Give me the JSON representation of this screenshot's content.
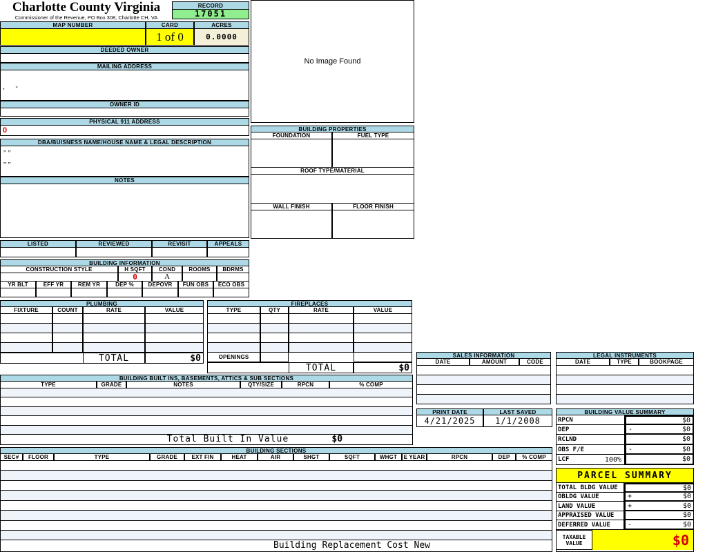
{
  "colors": {
    "header_blue": "#ADD8E6",
    "highlight_yellow": "#FFFF00",
    "record_green": "#90EE90",
    "acres_cream": "#F3EFD8",
    "alert_red": "#D40000",
    "row_stripe": "#EFF3FA"
  },
  "county": {
    "title": "Charlotte County Virginia",
    "subtitle": "Commissioner of the Revenue, PO Box 308, Charlotte CH, VA"
  },
  "record": {
    "label": "RECORD",
    "value": "17051"
  },
  "parcel_header": {
    "map_number_label": "MAP NUMBER",
    "map_number_value": "",
    "card_label": "CARD",
    "card_value": "1 of 0",
    "acres_label": "ACRES",
    "acres_value": "0.0000"
  },
  "owner": {
    "deeded_owner_label": "DEEDED OWNER",
    "deeded_owner_value": "",
    "mailing_address_label": "MAILING ADDRESS",
    "mailing_address_value": ",     -",
    "owner_id_label": "OWNER ID",
    "owner_id_value": "",
    "physical_911_label": "PHYSICAL 911 ADDRESS",
    "physical_911_value": "0",
    "dba_label": "DBA/BUISNESS NAME/HOUSE NAME & LEGAL DESCRIPTION",
    "dba_line1": "'' ''",
    "dba_line2": "'' ''",
    "notes_label": "NOTES",
    "notes_value": ""
  },
  "photo": {
    "placeholder": "No Image Found"
  },
  "building_properties": {
    "title": "BUILDING PROPERTIES",
    "foundation_label": "FOUNDATION",
    "foundation_value": "",
    "fuel_type_label": "FUEL TYPE",
    "fuel_type_value": "",
    "roof_label": "ROOF TYPE/MATERIAL",
    "roof_value": "",
    "wall_finish_label": "WALL FINISH",
    "wall_finish_value": "",
    "floor_finish_label": "FLOOR FINISH",
    "floor_finish_value": ""
  },
  "review": {
    "columns": [
      "LISTED",
      "REVIEWED",
      "REVISIT",
      "APPEALS"
    ],
    "values": [
      "",
      "",
      "",
      ""
    ]
  },
  "building_information": {
    "title": "BUILDING INFORMATION",
    "row1_labels": [
      "CONSTRUCTION STYLE",
      "H SQFT",
      "COND",
      "ROOMS",
      "BDRMS"
    ],
    "row1_values": [
      "",
      "0",
      "A",
      "",
      ""
    ],
    "row2_labels": [
      "YR BLT",
      "EFF YR",
      "REM YR",
      "DEP %",
      "DEPOVR",
      "FUN OBS",
      "ECO OBS"
    ],
    "row2_values": [
      "",
      "",
      "",
      "",
      "",
      "",
      ""
    ]
  },
  "plumbing": {
    "title": "PLUMBING",
    "columns": [
      "FIXTURE",
      "COUNT",
      "RATE",
      "VALUE"
    ],
    "total_label": "TOTAL",
    "total_value": "$0"
  },
  "fireplaces": {
    "title": "FIREPLACES",
    "columns": [
      "TYPE",
      "QTY",
      "RATE",
      "VALUE"
    ],
    "openings_label": "OPENINGS",
    "openings_value": "",
    "total_label": "TOTAL",
    "total_value": "$0"
  },
  "built_ins": {
    "title": "BUILDING BUILT INS, BASEMENTS, ATTICS & SUB SECTIONS",
    "columns": [
      "TYPE",
      "GRADE",
      "NOTES",
      "QTY/SIZE",
      "RPCN",
      "% COMP"
    ],
    "total_label": "Total Built In Value",
    "total_value": "$0"
  },
  "building_sections": {
    "title": "BUILDING SECTIONS",
    "columns": [
      "SEC#",
      "FLOOR",
      "TYPE",
      "GRADE",
      "EXT FIN",
      "HEAT",
      "AIR",
      "SHGT",
      "SQFT",
      "WHGT",
      "E YEAR",
      "RPCN",
      "DEP",
      "% COMP"
    ],
    "footer_label": "Building Replacement Cost New"
  },
  "sales_information": {
    "title": "SALES INFORMATION",
    "columns": [
      "DATE",
      "AMOUNT",
      "CODE"
    ]
  },
  "legal_instruments": {
    "title": "LEGAL INSTRUMENTS",
    "columns": [
      "DATE",
      "TYPE",
      "BOOKPAGE"
    ]
  },
  "dates": {
    "print_date_label": "PRINT DATE",
    "print_date_value": "4/21/2025",
    "last_saved_label": "LAST SAVED",
    "last_saved_value": "1/1/2008"
  },
  "building_value_summary": {
    "title": "BUILDING VALUE SUMMARY",
    "rows": [
      {
        "label": "RPCN",
        "pct": "",
        "op": "",
        "value": "$0"
      },
      {
        "label": "DEP",
        "pct": "",
        "op": "-",
        "value": "$0"
      },
      {
        "label": "RCLND",
        "pct": "",
        "op": "",
        "value": "$0"
      },
      {
        "label": "OBS F/E",
        "pct": "",
        "op": "-",
        "value": "$0"
      },
      {
        "label": "LCF",
        "pct": "100%",
        "op": "",
        "value": "$0"
      }
    ]
  },
  "parcel_summary": {
    "title": "PARCEL SUMMARY",
    "rows": [
      {
        "label": "TOTAL BLDG VALUE",
        "op": "",
        "value": "$0"
      },
      {
        "label": "OBLDG VALUE",
        "op": "+",
        "value": "$0"
      },
      {
        "label": "LAND VALUE",
        "op": "+",
        "value": "$0"
      },
      {
        "label": "APPRAISED VALUE",
        "op": "",
        "value": "$0"
      },
      {
        "label": "DEFERRED VALUE",
        "op": "-",
        "value": "$0"
      }
    ],
    "taxable_label_line1": "TAXABLE",
    "taxable_label_line2": "VALUE",
    "taxable_value": "$0"
  }
}
